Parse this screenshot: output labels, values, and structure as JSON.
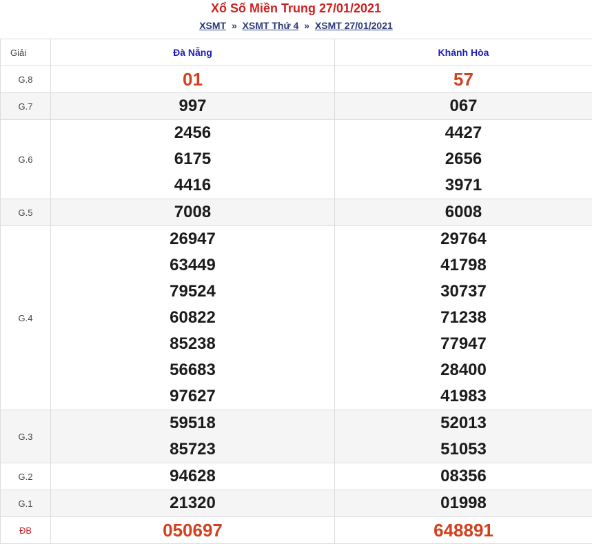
{
  "header": {
    "title": "Xổ Số Miền Trung 27/01/2021",
    "breadcrumb": [
      "XSMT",
      "XSMT Thứ 4",
      "XSMT 27/01/2021"
    ],
    "separator": "»"
  },
  "table": {
    "label_header": "Giải",
    "provinces": [
      "Đà Nẵng",
      "Khánh Hòa"
    ],
    "prizes": [
      {
        "label": "G.8",
        "p1": [
          "01"
        ],
        "p2": [
          "57"
        ]
      },
      {
        "label": "G.7",
        "p1": [
          "997"
        ],
        "p2": [
          "067"
        ]
      },
      {
        "label": "G.6",
        "p1": [
          "2456",
          "6175",
          "4416"
        ],
        "p2": [
          "4427",
          "2656",
          "3971"
        ]
      },
      {
        "label": "G.5",
        "p1": [
          "7008"
        ],
        "p2": [
          "6008"
        ]
      },
      {
        "label": "G.4",
        "p1": [
          "26947",
          "63449",
          "79524",
          "60822",
          "85238",
          "56683",
          "97627"
        ],
        "p2": [
          "29764",
          "41798",
          "30737",
          "71238",
          "77947",
          "28400",
          "41983"
        ]
      },
      {
        "label": "G.3",
        "p1": [
          "59518",
          "85723"
        ],
        "p2": [
          "52013",
          "51053"
        ]
      },
      {
        "label": "G.2",
        "p1": [
          "94628"
        ],
        "p2": [
          "08356"
        ]
      },
      {
        "label": "G.1",
        "p1": [
          "21320"
        ],
        "p2": [
          "01998"
        ]
      },
      {
        "label": "ĐB",
        "p1": [
          "050697"
        ],
        "p2": [
          "648891"
        ]
      }
    ]
  },
  "colors": {
    "title": "#d11f1f",
    "province_header": "#1d1ab8",
    "highlight_number": "#d2401e",
    "number": "#1b1b1b"
  }
}
